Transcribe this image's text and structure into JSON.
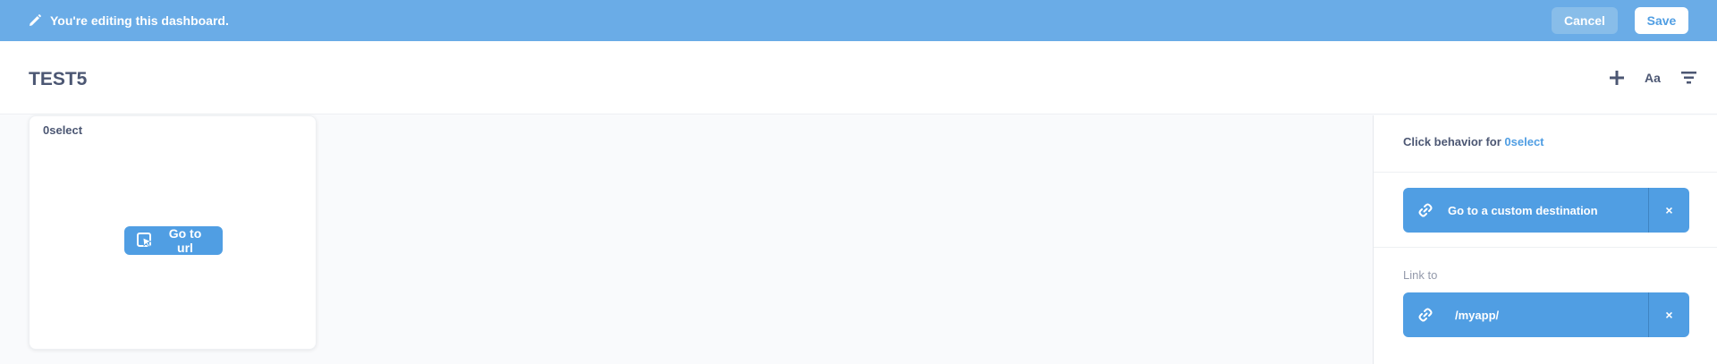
{
  "edit_bar": {
    "message": "You're editing this dashboard.",
    "cancel_label": "Cancel",
    "save_label": "Save"
  },
  "header": {
    "title": "TEST5",
    "text_icon_label": "Aa"
  },
  "card": {
    "title": "0select",
    "button_label": "Go to url"
  },
  "sidebar": {
    "click_behavior_prefix": "Click behavior for ",
    "click_behavior_target": "0select",
    "destination_label": "Go to a custom destination",
    "link_to_label": "Link to",
    "url_value": "/myapp/",
    "close_glyph": "×"
  },
  "colors": {
    "edit_bar_bg": "#6aace7",
    "accent": "#509ee3",
    "text": "#4c5773"
  },
  "icons": [
    "pencil-icon",
    "plus-icon",
    "filter-icon",
    "click-icon",
    "link-icon",
    "close-icon"
  ]
}
